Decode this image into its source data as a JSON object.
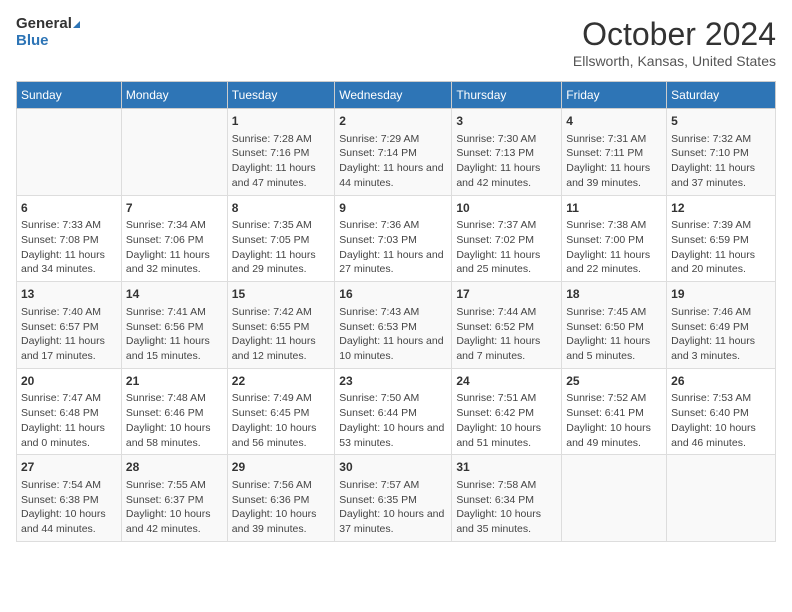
{
  "logo": {
    "line1": "General",
    "line2": "Blue"
  },
  "title": "October 2024",
  "subtitle": "Ellsworth, Kansas, United States",
  "days_of_week": [
    "Sunday",
    "Monday",
    "Tuesday",
    "Wednesday",
    "Thursday",
    "Friday",
    "Saturday"
  ],
  "weeks": [
    [
      {
        "num": "",
        "info": ""
      },
      {
        "num": "",
        "info": ""
      },
      {
        "num": "1",
        "info": "Sunrise: 7:28 AM\nSunset: 7:16 PM\nDaylight: 11 hours and 47 minutes."
      },
      {
        "num": "2",
        "info": "Sunrise: 7:29 AM\nSunset: 7:14 PM\nDaylight: 11 hours and 44 minutes."
      },
      {
        "num": "3",
        "info": "Sunrise: 7:30 AM\nSunset: 7:13 PM\nDaylight: 11 hours and 42 minutes."
      },
      {
        "num": "4",
        "info": "Sunrise: 7:31 AM\nSunset: 7:11 PM\nDaylight: 11 hours and 39 minutes."
      },
      {
        "num": "5",
        "info": "Sunrise: 7:32 AM\nSunset: 7:10 PM\nDaylight: 11 hours and 37 minutes."
      }
    ],
    [
      {
        "num": "6",
        "info": "Sunrise: 7:33 AM\nSunset: 7:08 PM\nDaylight: 11 hours and 34 minutes."
      },
      {
        "num": "7",
        "info": "Sunrise: 7:34 AM\nSunset: 7:06 PM\nDaylight: 11 hours and 32 minutes."
      },
      {
        "num": "8",
        "info": "Sunrise: 7:35 AM\nSunset: 7:05 PM\nDaylight: 11 hours and 29 minutes."
      },
      {
        "num": "9",
        "info": "Sunrise: 7:36 AM\nSunset: 7:03 PM\nDaylight: 11 hours and 27 minutes."
      },
      {
        "num": "10",
        "info": "Sunrise: 7:37 AM\nSunset: 7:02 PM\nDaylight: 11 hours and 25 minutes."
      },
      {
        "num": "11",
        "info": "Sunrise: 7:38 AM\nSunset: 7:00 PM\nDaylight: 11 hours and 22 minutes."
      },
      {
        "num": "12",
        "info": "Sunrise: 7:39 AM\nSunset: 6:59 PM\nDaylight: 11 hours and 20 minutes."
      }
    ],
    [
      {
        "num": "13",
        "info": "Sunrise: 7:40 AM\nSunset: 6:57 PM\nDaylight: 11 hours and 17 minutes."
      },
      {
        "num": "14",
        "info": "Sunrise: 7:41 AM\nSunset: 6:56 PM\nDaylight: 11 hours and 15 minutes."
      },
      {
        "num": "15",
        "info": "Sunrise: 7:42 AM\nSunset: 6:55 PM\nDaylight: 11 hours and 12 minutes."
      },
      {
        "num": "16",
        "info": "Sunrise: 7:43 AM\nSunset: 6:53 PM\nDaylight: 11 hours and 10 minutes."
      },
      {
        "num": "17",
        "info": "Sunrise: 7:44 AM\nSunset: 6:52 PM\nDaylight: 11 hours and 7 minutes."
      },
      {
        "num": "18",
        "info": "Sunrise: 7:45 AM\nSunset: 6:50 PM\nDaylight: 11 hours and 5 minutes."
      },
      {
        "num": "19",
        "info": "Sunrise: 7:46 AM\nSunset: 6:49 PM\nDaylight: 11 hours and 3 minutes."
      }
    ],
    [
      {
        "num": "20",
        "info": "Sunrise: 7:47 AM\nSunset: 6:48 PM\nDaylight: 11 hours and 0 minutes."
      },
      {
        "num": "21",
        "info": "Sunrise: 7:48 AM\nSunset: 6:46 PM\nDaylight: 10 hours and 58 minutes."
      },
      {
        "num": "22",
        "info": "Sunrise: 7:49 AM\nSunset: 6:45 PM\nDaylight: 10 hours and 56 minutes."
      },
      {
        "num": "23",
        "info": "Sunrise: 7:50 AM\nSunset: 6:44 PM\nDaylight: 10 hours and 53 minutes."
      },
      {
        "num": "24",
        "info": "Sunrise: 7:51 AM\nSunset: 6:42 PM\nDaylight: 10 hours and 51 minutes."
      },
      {
        "num": "25",
        "info": "Sunrise: 7:52 AM\nSunset: 6:41 PM\nDaylight: 10 hours and 49 minutes."
      },
      {
        "num": "26",
        "info": "Sunrise: 7:53 AM\nSunset: 6:40 PM\nDaylight: 10 hours and 46 minutes."
      }
    ],
    [
      {
        "num": "27",
        "info": "Sunrise: 7:54 AM\nSunset: 6:38 PM\nDaylight: 10 hours and 44 minutes."
      },
      {
        "num": "28",
        "info": "Sunrise: 7:55 AM\nSunset: 6:37 PM\nDaylight: 10 hours and 42 minutes."
      },
      {
        "num": "29",
        "info": "Sunrise: 7:56 AM\nSunset: 6:36 PM\nDaylight: 10 hours and 39 minutes."
      },
      {
        "num": "30",
        "info": "Sunrise: 7:57 AM\nSunset: 6:35 PM\nDaylight: 10 hours and 37 minutes."
      },
      {
        "num": "31",
        "info": "Sunrise: 7:58 AM\nSunset: 6:34 PM\nDaylight: 10 hours and 35 minutes."
      },
      {
        "num": "",
        "info": ""
      },
      {
        "num": "",
        "info": ""
      }
    ]
  ]
}
